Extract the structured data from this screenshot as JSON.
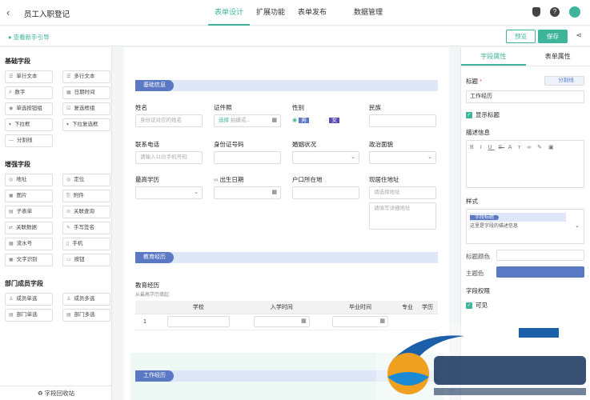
{
  "app": {
    "back": "‹",
    "title": "员工入职登记"
  },
  "nav": {
    "tabs": [
      "表单设计",
      "扩展功能",
      "表单发布",
      "数据管理"
    ]
  },
  "toolbar": {
    "guide": "查看新手引导",
    "preview": "预览",
    "save": "保存"
  },
  "left": {
    "basic_title": "基础字段",
    "basic": [
      {
        "glyph": "☰",
        "label": "单行文本"
      },
      {
        "glyph": "☰",
        "label": "多行文本"
      },
      {
        "glyph": "#",
        "label": "数字"
      },
      {
        "glyph": "▦",
        "label": "日期时间"
      },
      {
        "glyph": "◉",
        "label": "单选按钮组"
      },
      {
        "glyph": "☑",
        "label": "复选框组"
      },
      {
        "glyph": "▾",
        "label": "下拉框"
      },
      {
        "glyph": "▾",
        "label": "下拉复选框"
      },
      {
        "glyph": "—",
        "label": "分割线"
      }
    ],
    "enhanced_title": "增强字段",
    "enhanced": [
      {
        "glyph": "◎",
        "label": "地址"
      },
      {
        "glyph": "◎",
        "label": "定位"
      },
      {
        "glyph": "▣",
        "label": "图片"
      },
      {
        "glyph": "⎘",
        "label": "附件"
      },
      {
        "glyph": "▤",
        "label": "子表单"
      },
      {
        "glyph": "⊙",
        "label": "关联查询"
      },
      {
        "glyph": "⇄",
        "label": "关联数据"
      },
      {
        "glyph": "✎",
        "label": "手写签名"
      },
      {
        "glyph": "▦",
        "label": "流水号"
      },
      {
        "glyph": "▯",
        "label": "手机"
      },
      {
        "glyph": "▣",
        "label": "文字识别"
      },
      {
        "glyph": "▭",
        "label": "按钮"
      }
    ],
    "dept_title": "部门成员字段",
    "dept": [
      {
        "glyph": "♙",
        "label": "成员单选"
      },
      {
        "glyph": "♙",
        "label": "成员多选"
      },
      {
        "glyph": "▤",
        "label": "部门单选"
      },
      {
        "glyph": "▤",
        "label": "部门多选"
      }
    ],
    "recycle": "字段回收站"
  },
  "form": {
    "section1": "基础信息",
    "name_label": "姓名",
    "name_ph": "身份证对应的姓名",
    "id_label": "证件照",
    "id_select": "选择",
    "id_hint": "拍摄或...",
    "gender_label": "性别",
    "male": "男",
    "female": "女",
    "ethnic_label": "民族",
    "phone_label": "联系电话",
    "phone_ph": "请输入11位手机号码",
    "idno_label": "身份证号码",
    "marital_label": "婚姻状况",
    "political_label": "政治面貌",
    "edu_label": "最高学历",
    "birth_label": "出生日期",
    "hukou_label": "户口所在地",
    "addr_label": "现居住地址",
    "addr_ph": "请选择地址",
    "addr_detail_ph": "请填写详细地址",
    "section2": "教育经历",
    "edu_exp_label": "教育经历",
    "edu_exp_hint": "从最高学历填起",
    "table_headers": [
      "学校",
      "入学时间",
      "毕业时间",
      "专业",
      "学历"
    ],
    "row_no": "1",
    "section3": "工作经历"
  },
  "right": {
    "tab1": "字段属性",
    "tab2": "表单属性",
    "title_label": "标题",
    "required_mark": "*",
    "divider_btn": "分割线",
    "title_value": "工作经历",
    "show_title": "显示标题",
    "desc_label": "描述信息",
    "style_label": "样式",
    "style_tag": "字段标题",
    "style_desc": "这里是字段的描述信息",
    "title_color_label": "标题颜色",
    "theme_color_label": "主题色",
    "theme_color": "#5a78c4",
    "perm_label": "字段权限",
    "visible": "可见"
  },
  "colors": {
    "accent": "#3eb59a",
    "section": "#5a78c4"
  }
}
